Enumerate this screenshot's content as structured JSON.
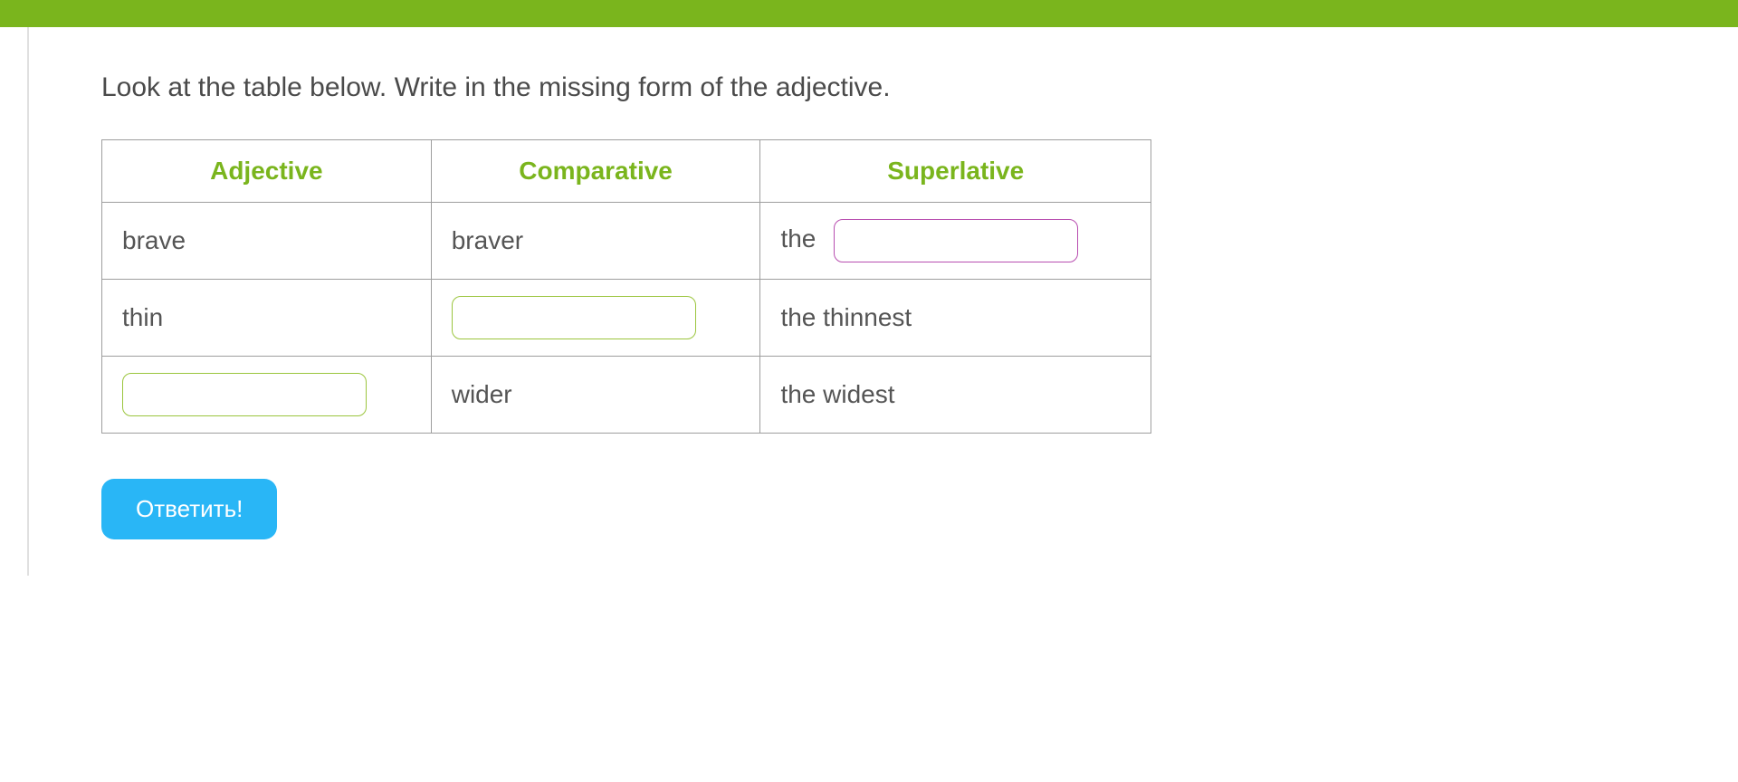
{
  "instruction": "Look at the table below. Write in the missing form of the adjective.",
  "headers": {
    "col1": "Adjective",
    "col2": "Comparative",
    "col3": "Superlative"
  },
  "rows": [
    {
      "adjective": "brave",
      "comparative": "braver",
      "superlative_prefix": "the",
      "superlative_input": ""
    },
    {
      "adjective": "thin",
      "comparative_input": "",
      "superlative": "the thinnest"
    },
    {
      "adjective_input": "",
      "comparative": "wider",
      "superlative": "the widest"
    }
  ],
  "button_label": "Ответить!"
}
